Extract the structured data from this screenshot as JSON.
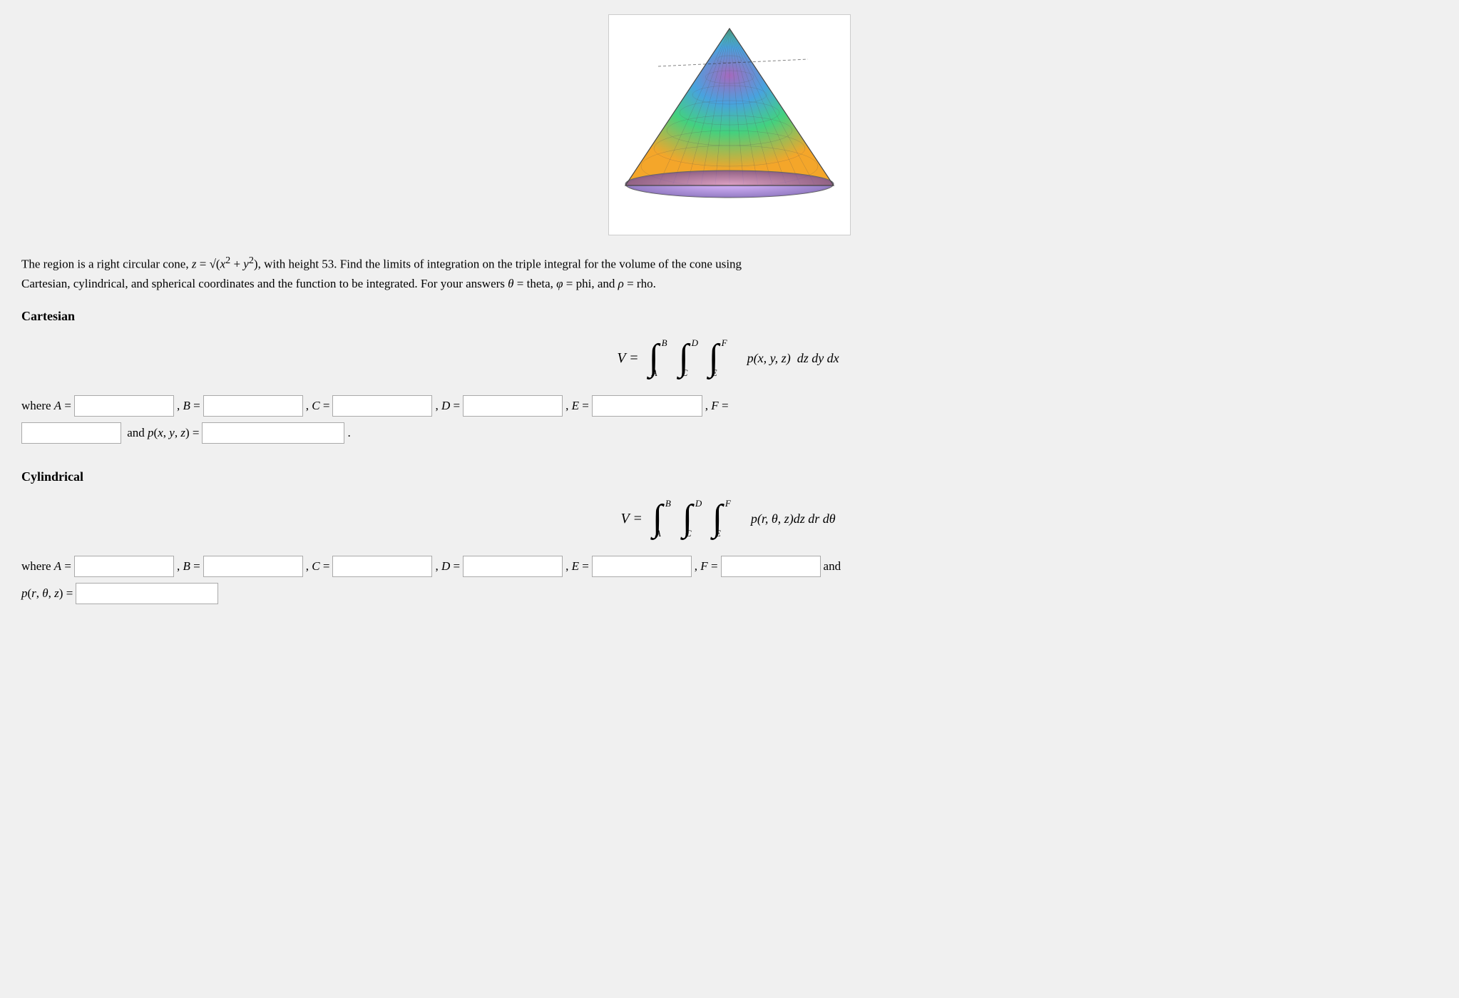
{
  "page": {
    "cone_alt": "3D cone visualization",
    "problem_text_1": "The region is a right circular cone, z = √(x² + y²), with height 53. Find the limits of integration on the triple integral for the volume of the cone",
    "problem_text_2": "using Cartesian, cylindrical, and spherical coordinates and the function to be integrated. For your answers θ = theta, φ = phi, and ρ = rho.",
    "sections": [
      {
        "id": "cartesian",
        "title": "Cartesian",
        "integral_label": "V =",
        "integral_bounds": [
          {
            "upper": "B",
            "lower": "A"
          },
          {
            "upper": "D",
            "lower": "C"
          },
          {
            "upper": "F",
            "lower": "E"
          }
        ],
        "integrand": "p(x, y, z)  dz dy dx",
        "where_label": "where A =",
        "fields": [
          "A",
          "B",
          "C",
          "D",
          "E",
          "F"
        ],
        "second_line_label": "and p(x, y, z) =",
        "inputs": {
          "A": "",
          "B": "",
          "C": "",
          "D": "",
          "E": "",
          "F": "",
          "p": ""
        }
      },
      {
        "id": "cylindrical",
        "title": "Cylindrical",
        "integral_label": "V =",
        "integral_bounds": [
          {
            "upper": "B",
            "lower": "A"
          },
          {
            "upper": "D",
            "lower": "C"
          },
          {
            "upper": "F",
            "lower": "E"
          }
        ],
        "integrand": "p(r, θ, z)dz dr dθ",
        "where_label": "where A =",
        "fields": [
          "A",
          "B",
          "C",
          "D",
          "E",
          "F"
        ],
        "second_line_label": "and p(r, θ, z) =",
        "inputs": {
          "A": "",
          "B": "",
          "C": "",
          "D": "",
          "E": "",
          "F": "",
          "p": ""
        }
      }
    ],
    "labels": {
      "where": "where",
      "A_eq": "A =",
      "B_eq": ", B =",
      "C_eq": ", C =",
      "D_eq": ", D =",
      "E_eq": ", E =",
      "F_eq": ", F =",
      "and": "and"
    }
  }
}
